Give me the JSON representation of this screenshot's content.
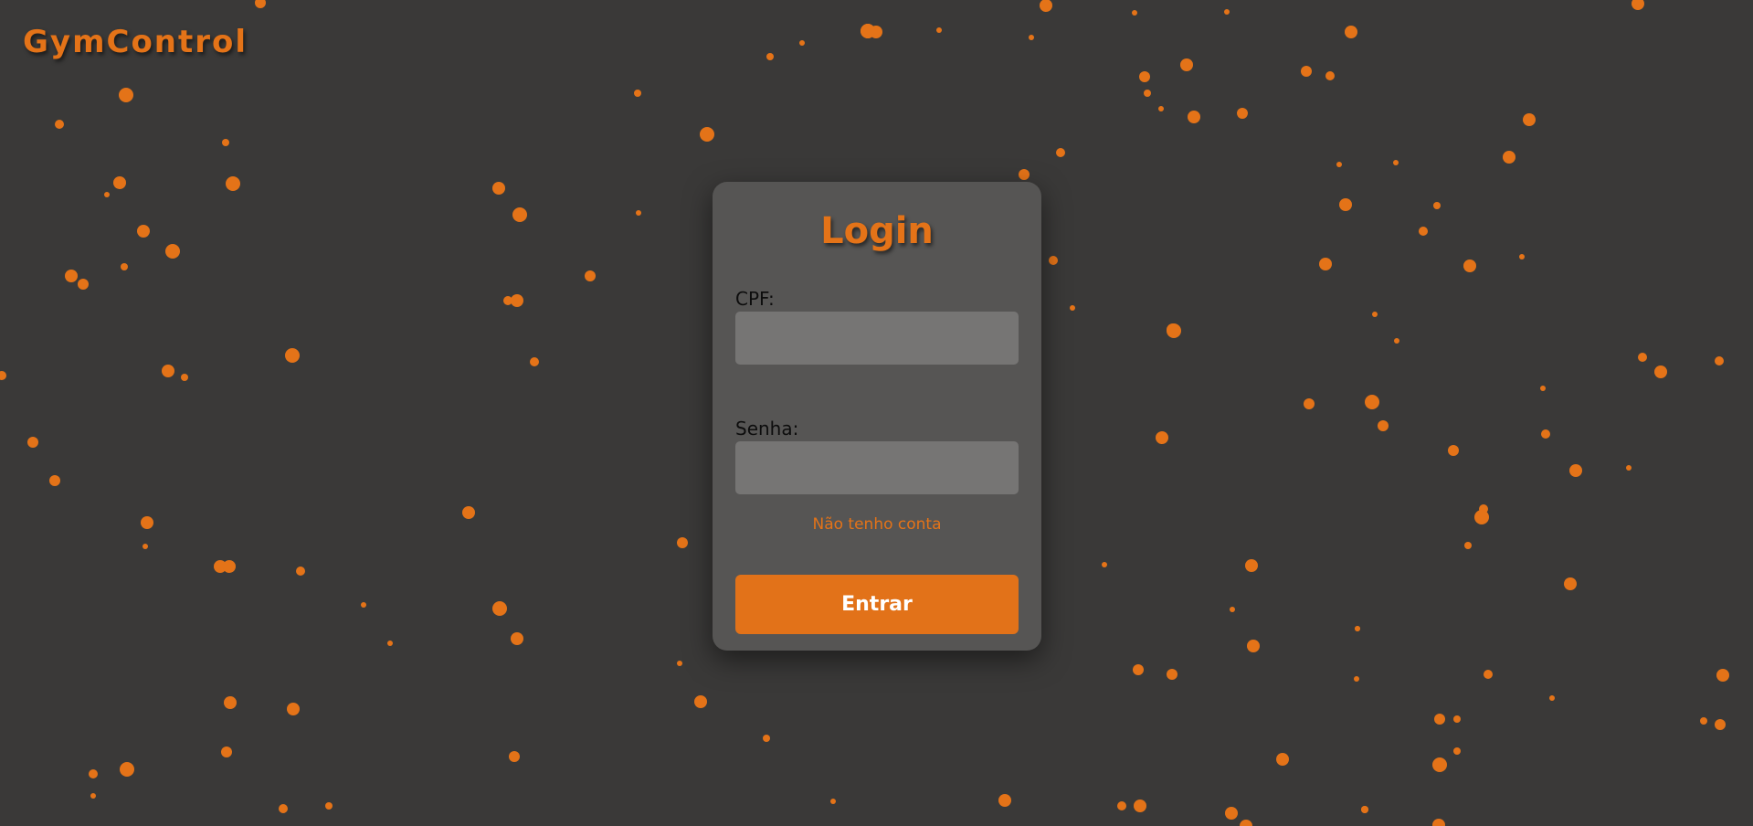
{
  "brand": {
    "title": "GymControl"
  },
  "login_form": {
    "title": "Login",
    "cpf_label": "CPF:",
    "cpf_value": "",
    "password_label": "Senha:",
    "password_value": "",
    "no_account_link": "Não tenho conta",
    "submit_label": "Entrar"
  },
  "colors": {
    "background": "#3a3938",
    "accent": "#e47318",
    "card": "#585756",
    "input": "#767574",
    "particle": "#e47318"
  },
  "background_effect": {
    "type": "particles",
    "icon": "orange-dot"
  }
}
